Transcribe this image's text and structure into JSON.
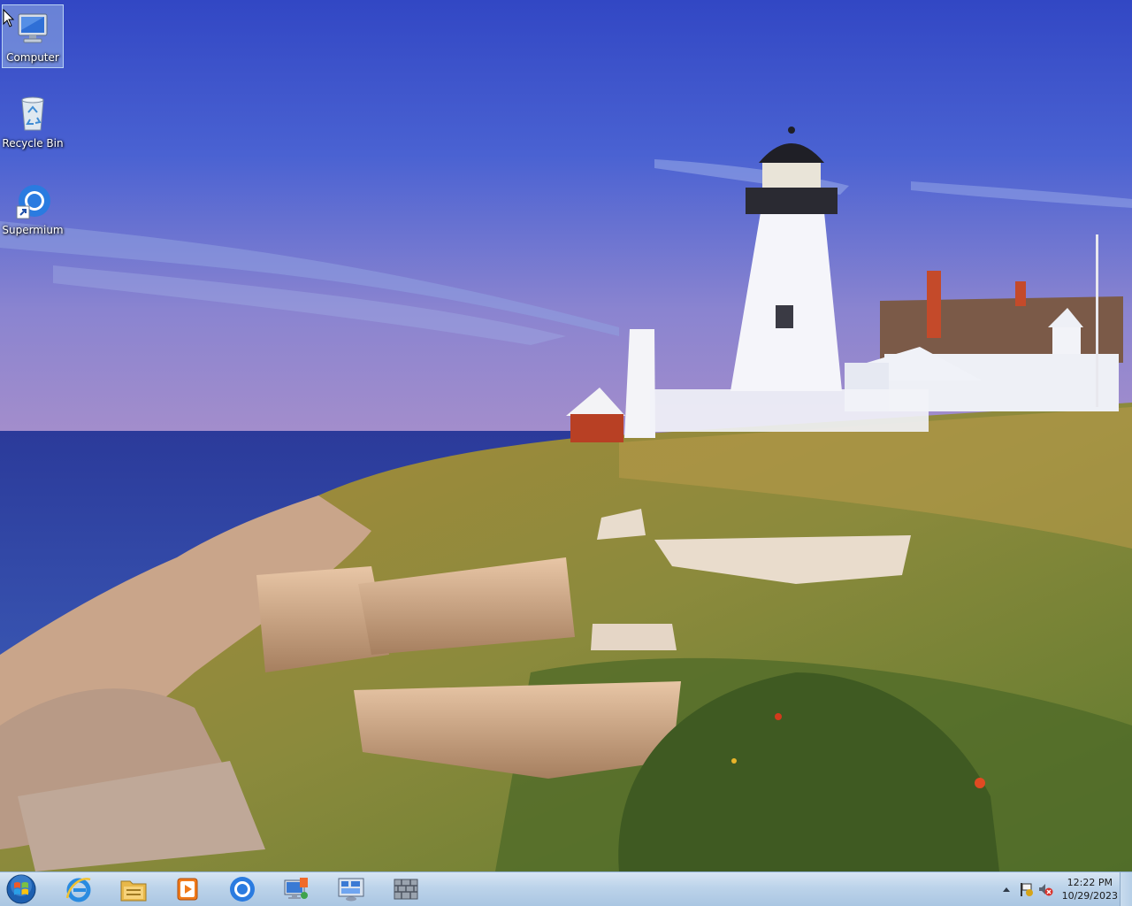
{
  "desktop": {
    "icons": [
      {
        "label": "Computer",
        "icon": "computer-icon",
        "selected": true
      },
      {
        "label": "Recycle Bin",
        "icon": "recycle-bin-icon",
        "selected": false
      },
      {
        "label": "Supermium",
        "icon": "supermium-browser-icon",
        "selected": false
      }
    ],
    "wallpaper": "lighthouse-coast-wallpaper"
  },
  "taskbar": {
    "start_button": "windows-start-orb-icon",
    "pinned_apps": [
      {
        "name": "Internet Explorer",
        "icon": "internet-explorer-icon"
      },
      {
        "name": "Windows Explorer",
        "icon": "file-explorer-icon"
      },
      {
        "name": "Windows Media Player",
        "icon": "media-player-icon"
      },
      {
        "name": "Supermium",
        "icon": "supermium-browser-icon"
      },
      {
        "name": "Remote Desktop",
        "icon": "remote-desktop-icon"
      },
      {
        "name": "Network",
        "icon": "network-icon"
      },
      {
        "name": "Firewall",
        "icon": "firewall-icon"
      }
    ],
    "tray": {
      "icons": [
        "show-hidden-icons-arrow",
        "action-center-flag-icon",
        "volume-muted-icon"
      ],
      "time": "12:22 PM",
      "date": "10/29/2023"
    }
  },
  "colors": {
    "taskbar_top": "#d7e5f3",
    "taskbar_bottom": "#aac6e2",
    "sky": "#3e58c9",
    "sea": "#2a3f9e"
  }
}
